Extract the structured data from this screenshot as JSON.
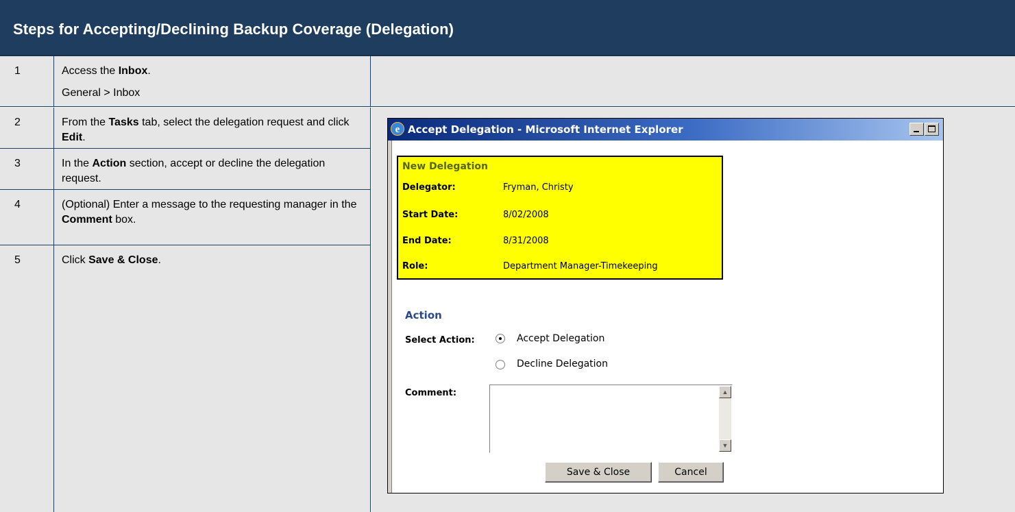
{
  "header": {
    "title": "Steps for Accepting/Declining Backup Coverage (Delegation)",
    "background": "#1f3d5e"
  },
  "steps": [
    {
      "num": "1",
      "pre": "Access the ",
      "bold": "Inbox",
      "post": ".",
      "sub": "General > Inbox"
    },
    {
      "num": "2",
      "pre": "From the ",
      "bold": "Tasks",
      "mid": " tab, select the delegation request and click ",
      "bold2": "Edit",
      "post": "."
    },
    {
      "num": "3",
      "pre": "In the ",
      "bold": "Action",
      "post": " section, accept or decline the delegation request."
    },
    {
      "num": "4",
      "pre": "(Optional) Enter a message to the requesting manager in the ",
      "bold": "Comment",
      "post": " box."
    },
    {
      "num": "5",
      "pre": "Click ",
      "bold": "Save & Close",
      "post": "."
    }
  ],
  "window": {
    "title": "Accept Delegation - Microsoft Internet Explorer",
    "icon": "ie-icon",
    "card": {
      "title": "New Delegation",
      "background": "#ffff00",
      "fields": [
        {
          "label": "Delegator:",
          "value": "Fryman, Christy"
        },
        {
          "label": "Start Date:",
          "value": "8/02/2008"
        },
        {
          "label": "End Date:",
          "value": "8/31/2008"
        },
        {
          "label": "Role:",
          "value": "Department Manager-Timekeeping"
        }
      ]
    },
    "action": {
      "section_title": "Action",
      "select_label": "Select Action:",
      "options": [
        {
          "label": "Accept Delegation",
          "selected": true
        },
        {
          "label": "Decline Delegation",
          "selected": false
        }
      ],
      "comment_label": "Comment:",
      "comment_value": ""
    },
    "buttons": {
      "save_close": "Save & Close",
      "cancel": "Cancel"
    }
  }
}
